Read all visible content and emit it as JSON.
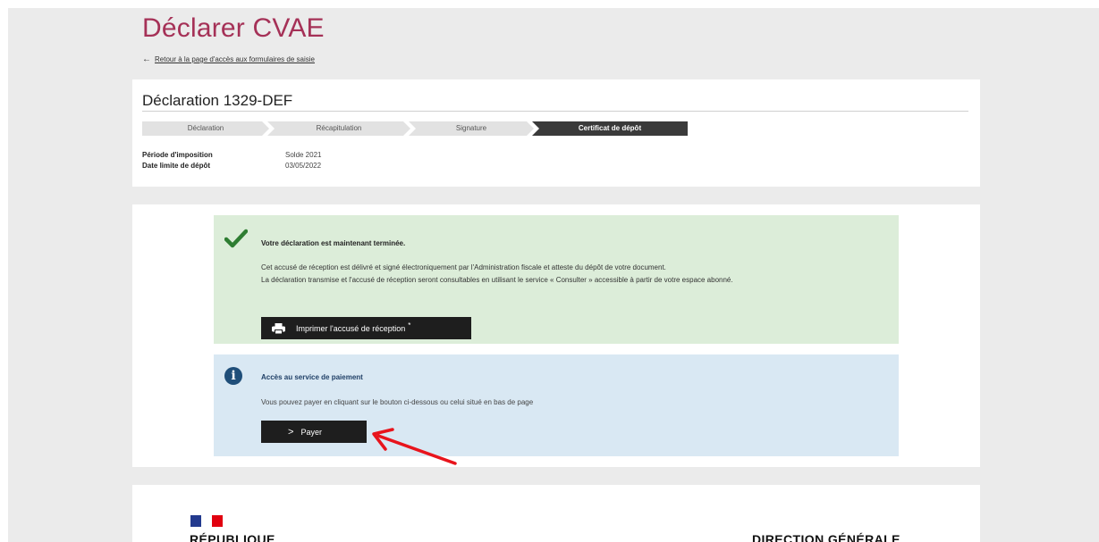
{
  "page": {
    "title": "Déclarer CVAE",
    "back_link": "Retour à la page d'accès aux formulaires de saisie",
    "accent_color": "#a53157"
  },
  "declaration": {
    "title": "Déclaration 1329-DEF",
    "steps": [
      {
        "label": "Déclaration",
        "active": false
      },
      {
        "label": "Récapitulation",
        "active": false
      },
      {
        "label": "Signature",
        "active": false
      },
      {
        "label": "Certificat de dépôt",
        "active": true
      }
    ],
    "meta": [
      {
        "label": "Période d'imposition",
        "value": "Solde 2021"
      },
      {
        "label": "Date limite de dépôt",
        "value": "03/05/2022"
      }
    ]
  },
  "success": {
    "icon": "check-icon",
    "title": "Votre déclaration est maintenant terminée.",
    "line1": "Cet accusé de réception est délivré et signé électroniquement par l'Administration fiscale et atteste du dépôt de votre document.",
    "line2": "La déclaration transmise et l'accusé de réception seront consultables en utilisant le service « Consulter » accessible à partir de votre espace abonné.",
    "print_button": "Imprimer l'accusé de réception",
    "print_button_mark": "*"
  },
  "payment": {
    "icon": "info-icon",
    "title": "Accès au service de paiement",
    "text": "Vous pouvez payer en cliquant sur le bouton ci-dessous ou celui situé en bas de page",
    "pay_button": "Payer"
  },
  "footer": {
    "republique": "RÉPUBLIQUE",
    "direction": "DIRECTION GÉNÉRALE"
  },
  "colors": {
    "success_bg": "#dcedd9",
    "info_bg": "#d9e8f3",
    "button_bg": "#1e1e1e",
    "annotation_arrow": "#e8141c"
  }
}
